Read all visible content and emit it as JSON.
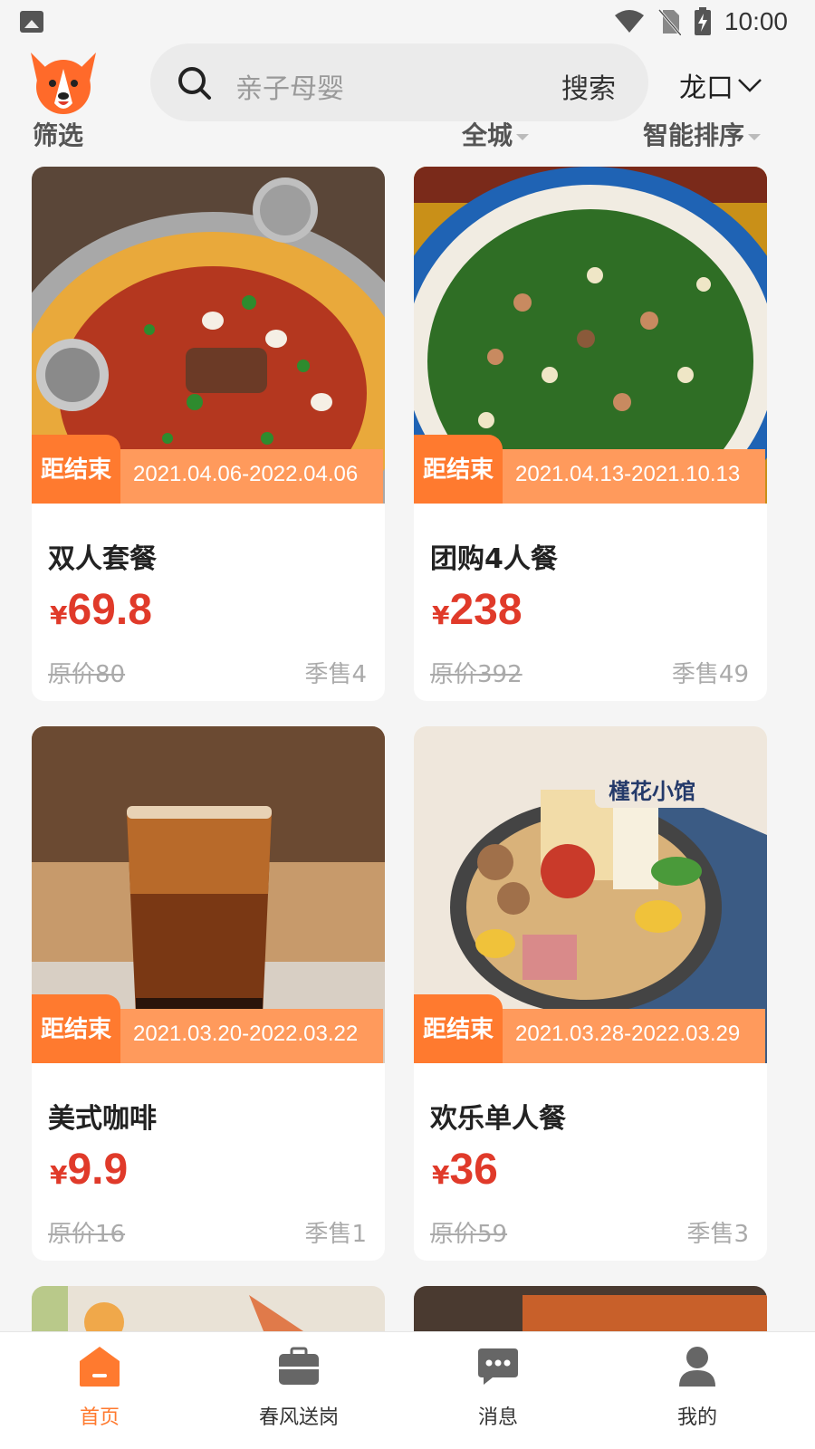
{
  "status_bar": {
    "time": "10:00"
  },
  "header": {
    "search_placeholder": "亲子母婴",
    "search_button": "搜索",
    "city": "龙口"
  },
  "filters": {
    "filter": "筛选",
    "area": "全城",
    "sort": "智能排序"
  },
  "cards": [
    {
      "badge": "距结束",
      "date_range": "2021.04.06-2022.04.06",
      "name": "双人套餐",
      "currency": "¥",
      "price": "69.8",
      "original": "原价80",
      "sold": "季售4"
    },
    {
      "badge": "距结束",
      "date_range": "2021.04.13-2021.10.13",
      "name": "团购4人餐",
      "currency": "¥",
      "price": "238",
      "original": "原价392",
      "sold": "季售49"
    },
    {
      "badge": "距结束",
      "date_range": "2021.03.20-2022.03.22",
      "name": "美式咖啡",
      "currency": "¥",
      "price": "9.9",
      "original": "原价16",
      "sold": "季售1"
    },
    {
      "badge": "距结束",
      "date_range": "2021.03.28-2022.03.29",
      "name": "欢乐单人餐",
      "currency": "¥",
      "price": "36",
      "original": "原价59",
      "sold": "季售3",
      "brand_logo": "槿花小馆"
    }
  ],
  "tabbar": [
    {
      "label": "首页",
      "icon": "home-icon",
      "active": true
    },
    {
      "label": "春风送岗",
      "icon": "briefcase-icon",
      "active": false
    },
    {
      "label": "消息",
      "icon": "message-icon",
      "active": false
    },
    {
      "label": "我的",
      "icon": "user-icon",
      "active": false
    }
  ],
  "colors": {
    "accent": "#ff7a2f",
    "price": "#e03a2a",
    "badge_light": "#ff9a5c"
  }
}
